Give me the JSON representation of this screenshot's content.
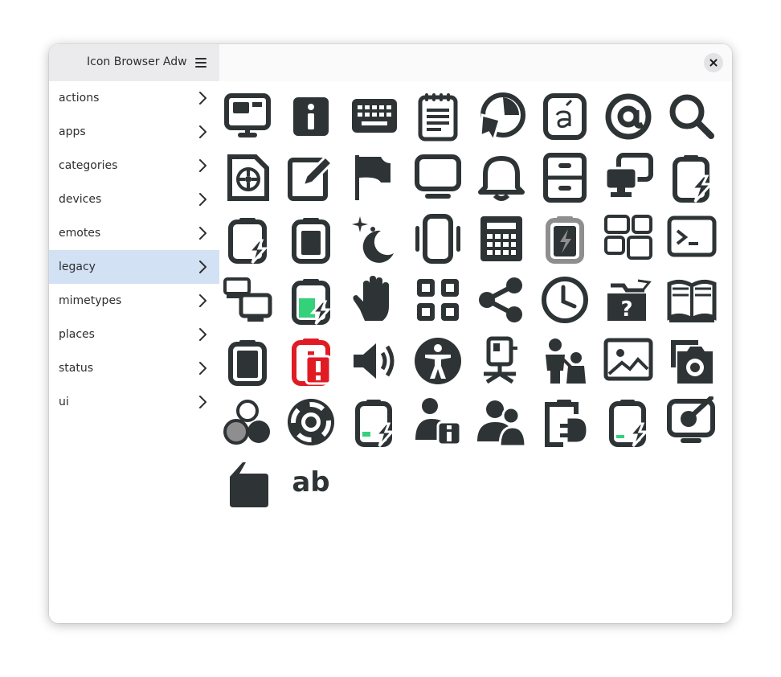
{
  "app": {
    "title": "Icon Browser Adw"
  },
  "header": {
    "menu_icon": "hamburger-menu-icon",
    "close_icon": "close-icon"
  },
  "sidebar": {
    "items": [
      {
        "label": "actions",
        "selected": false
      },
      {
        "label": "apps",
        "selected": false
      },
      {
        "label": "categories",
        "selected": false
      },
      {
        "label": "devices",
        "selected": false
      },
      {
        "label": "emotes",
        "selected": false
      },
      {
        "label": "legacy",
        "selected": true
      },
      {
        "label": "mimetypes",
        "selected": false
      },
      {
        "label": "places",
        "selected": false
      },
      {
        "label": "status",
        "selected": false
      },
      {
        "label": "ui",
        "selected": false
      }
    ]
  },
  "icons": [
    "preferences-desktop-icon",
    "dialog-information-icon",
    "keyboard-icon",
    "text-document-icon",
    "web-browser-icon",
    "font-icon",
    "mail-at-icon",
    "search-icon",
    "media-optical-icon",
    "edit-document-icon",
    "flag-icon",
    "computer-icon",
    "bell-notification-icon",
    "file-cabinet-icon",
    "network-computers-icon",
    "battery-charging-icon",
    "battery-charging-icon",
    "battery-full-icon",
    "night-mode-icon",
    "phone-vibrate-icon",
    "calculator-icon",
    "battery-charging-gray-icon",
    "window-tiles-icon",
    "terminal-icon",
    "display-projector-icon",
    "battery-good-charging-icon",
    "hand-stop-icon",
    "apps-grid-icon",
    "share-icon",
    "clock-icon",
    "folder-unknown-icon",
    "book-icon",
    "battery-full-icon",
    "battery-caution-icon",
    "speaker-volume-icon",
    "accessibility-icon",
    "camera-tripod-icon",
    "parent-child-icon",
    "image-icon",
    "camera-photo-icon",
    "color-circles-icon",
    "lifebuoy-help-icon",
    "battery-low-charging-icon",
    "user-info-icon",
    "users-group-icon",
    "ac-adapter-icon",
    "battery-caution-charging-icon",
    "display-settings-icon",
    "sd-card-icon",
    "font-ab-icon"
  ],
  "colors": {
    "icon_dark": "#2e3436",
    "icon_gray": "#8e8e8e",
    "battery_green": "#33d17a",
    "battery_red": "#e01b24",
    "selection": "#d3e1f5"
  }
}
